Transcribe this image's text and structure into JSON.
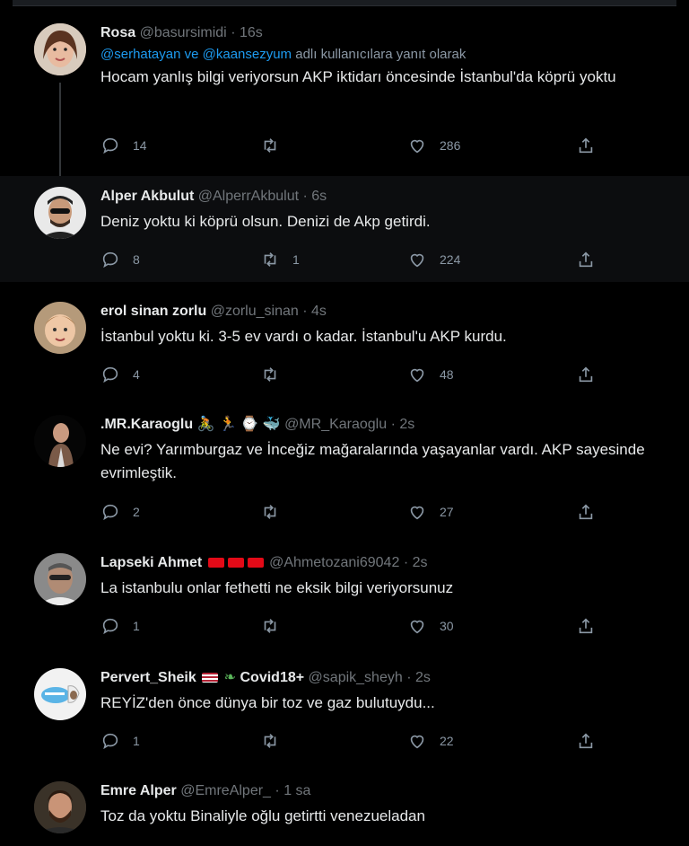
{
  "tweets": [
    {
      "name": "Rosa",
      "handle": "@basursimidi",
      "time": "16s",
      "reply_mentions": "@serhatayan ve @kaansezyum",
      "reply_suffix": "adlı kullanıcılara yanıt olarak",
      "text": "Hocam yanlış bilgi veriyorsun AKP iktidarı öncesinde İstanbul'da köprü yoktu",
      "replies": "14",
      "retweets": "",
      "likes": "286"
    },
    {
      "name": "Alper Akbulut",
      "handle": "@AlperrAkbulut",
      "time": "6s",
      "text": "Deniz yoktu ki köprü olsun. Denizi de Akp getirdi.",
      "replies": "8",
      "retweets": "1",
      "likes": "224"
    },
    {
      "name": "erol sinan zorlu",
      "handle": "@zorlu_sinan",
      "time": "4s",
      "text": "İstanbul yoktu ki. 3-5 ev vardı o kadar. İstanbul'u AKP kurdu.",
      "replies": "4",
      "retweets": "",
      "likes": "48"
    },
    {
      "name": ".MR.Karaoglu",
      "name_emoji": "🚴 🏃 ⌚ 🐳",
      "handle": "@MR_Karaoglu",
      "time": "2s",
      "text": "Ne evi? Yarımburgaz ve İnceğiz mağaralarında yaşayanlar vardı. AKP sayesinde evrimleştik.",
      "replies": "2",
      "retweets": "",
      "likes": "27"
    },
    {
      "name": "Lapseki Ahmet",
      "handle": "@Ahmetozani69042",
      "time": "2s",
      "text": "La istanbulu onlar fethetti ne eksik bilgi veriyorsunuz",
      "replies": "1",
      "retweets": "",
      "likes": "30"
    },
    {
      "name": "Pervert_Sheik",
      "name_suffix": "Covid18+",
      "handle": "@sapik_sheyh",
      "time": "2s",
      "text": "REYİZ'den önce dünya bir toz ve gaz bulutuydu...",
      "replies": "1",
      "retweets": "",
      "likes": "22"
    },
    {
      "name": "Emre Alper",
      "handle": "@EmreAlper_",
      "time": "1 sa",
      "text": "Toz da yoktu Binaliyle oğlu getirtti venezueladan"
    }
  ],
  "separator": "·",
  "colors": {
    "background": "#000000",
    "text": "#e7e9ea",
    "muted": "#71767b",
    "link": "#1d9bf0"
  },
  "icons": [
    "reply-icon",
    "retweet-icon",
    "like-icon",
    "share-icon"
  ]
}
